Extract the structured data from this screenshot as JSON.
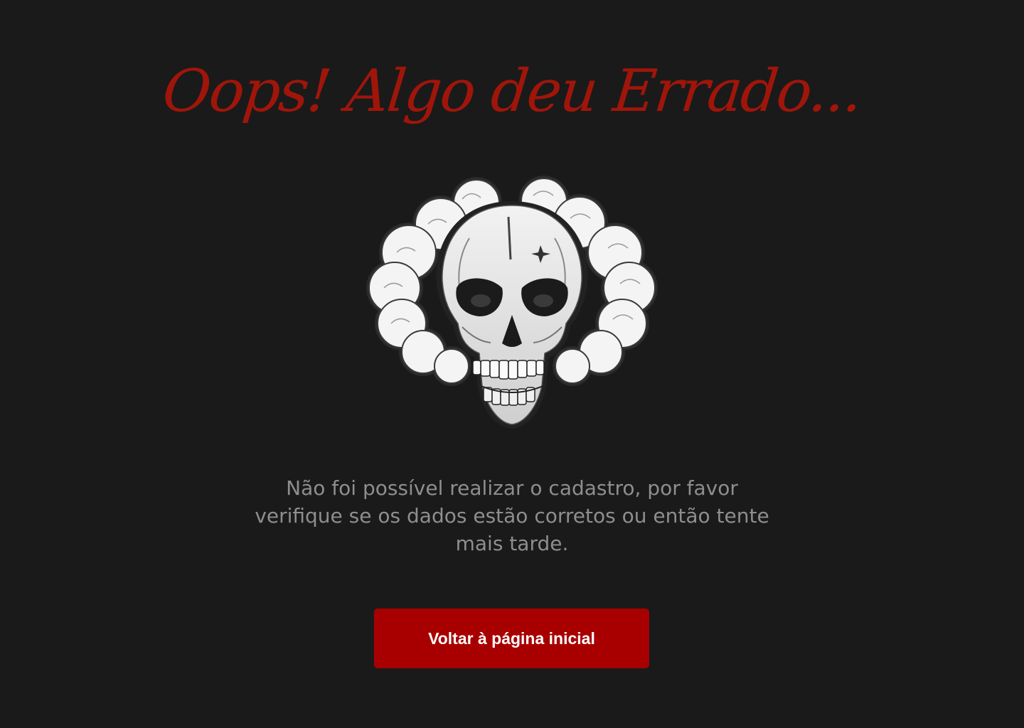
{
  "error_page": {
    "title": "Oops! Algo deu Errado...",
    "illustration_icon": "skull-smoke-icon",
    "message": "Não foi possível realizar o cadastro, por favor verifique se os dados estão corretos ou então tente mais tarde.",
    "home_button_label": "Voltar à página inicial"
  },
  "colors": {
    "background": "#1a1a1a",
    "title": "#a0150a",
    "message_text": "#8e8e8e",
    "button_background": "#a80000",
    "button_text": "#ffffff"
  }
}
